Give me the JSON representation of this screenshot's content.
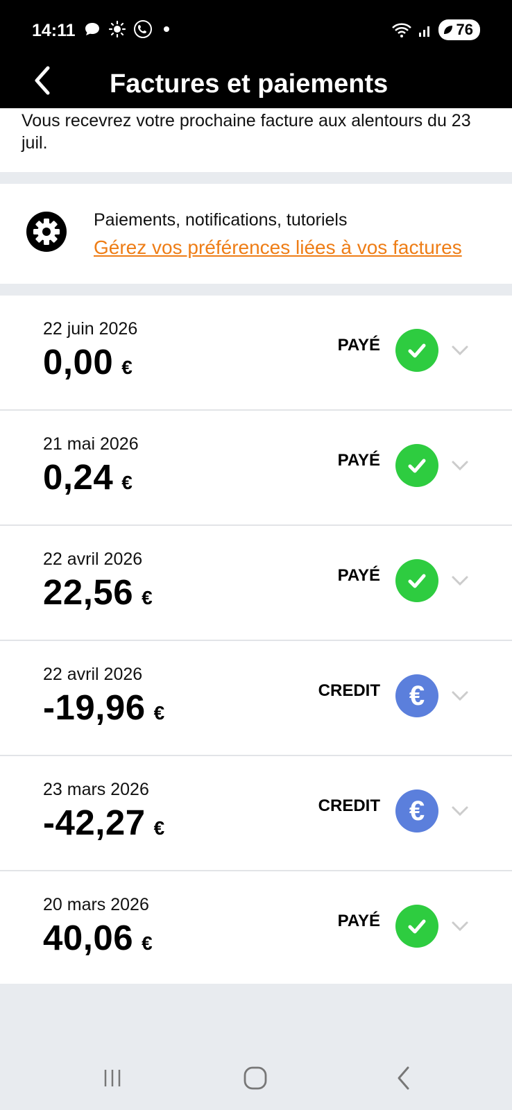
{
  "status_bar": {
    "time": "14:11",
    "battery": "76"
  },
  "header": {
    "title": "Factures et paiements"
  },
  "notice": {
    "text": "Vous recevrez votre prochaine facture aux alentours du 23 juil."
  },
  "preferences": {
    "title": "Paiements, notifications, tutoriels",
    "link": "Gérez vos préférences liées à vos factures"
  },
  "invoices": [
    {
      "date": "22 juin 2026",
      "amount": "0,00",
      "currency": "€",
      "status": "PAYÉ",
      "badge": "check-icon"
    },
    {
      "date": "21 mai 2026",
      "amount": "0,24",
      "currency": "€",
      "status": "PAYÉ",
      "badge": "check-icon"
    },
    {
      "date": "22 avril 2026",
      "amount": "22,56",
      "currency": "€",
      "status": "PAYÉ",
      "badge": "check-icon"
    },
    {
      "date": "22 avril 2026",
      "amount": "-19,96",
      "currency": "€",
      "status": "CREDIT",
      "badge": "euro-icon"
    },
    {
      "date": "23 mars 2026",
      "amount": "-42,27",
      "currency": "€",
      "status": "CREDIT",
      "badge": "euro-icon"
    },
    {
      "date": "20 mars 2026",
      "amount": "40,06",
      "currency": "€",
      "status": "PAYÉ",
      "badge": "check-icon"
    }
  ],
  "colors": {
    "paid": "#2ecc40",
    "credit": "#5b7fdc",
    "link": "#ee7d16"
  }
}
